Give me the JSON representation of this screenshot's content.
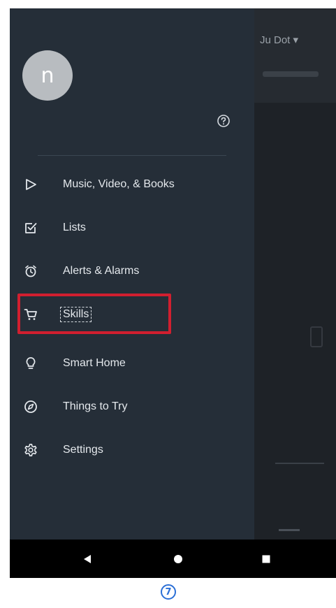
{
  "background_app": {
    "device_name": "Ju Dot ▾"
  },
  "drawer": {
    "avatar_initial": "n",
    "menu_items": [
      {
        "label": "Music, Video, & Books",
        "icon": "play-outline-icon"
      },
      {
        "label": "Lists",
        "icon": "checkbox-icon"
      },
      {
        "label": "Alerts & Alarms",
        "icon": "alarm-clock-icon"
      },
      {
        "label": "Skills",
        "icon": "shopping-cart-icon"
      },
      {
        "label": "Smart Home",
        "icon": "lightbulb-icon"
      },
      {
        "label": "Things to Try",
        "icon": "compass-icon"
      },
      {
        "label": "Settings",
        "icon": "gear-icon"
      }
    ]
  },
  "system_nav": {
    "back_icon": "triangle-back-icon",
    "home_icon": "circle-home-icon",
    "recents_icon": "square-recents-icon"
  },
  "step_badge": "7",
  "colors": {
    "drawer_bg": "#252e38",
    "highlight": "#d11f2f",
    "badge": "#2b6fd6"
  }
}
